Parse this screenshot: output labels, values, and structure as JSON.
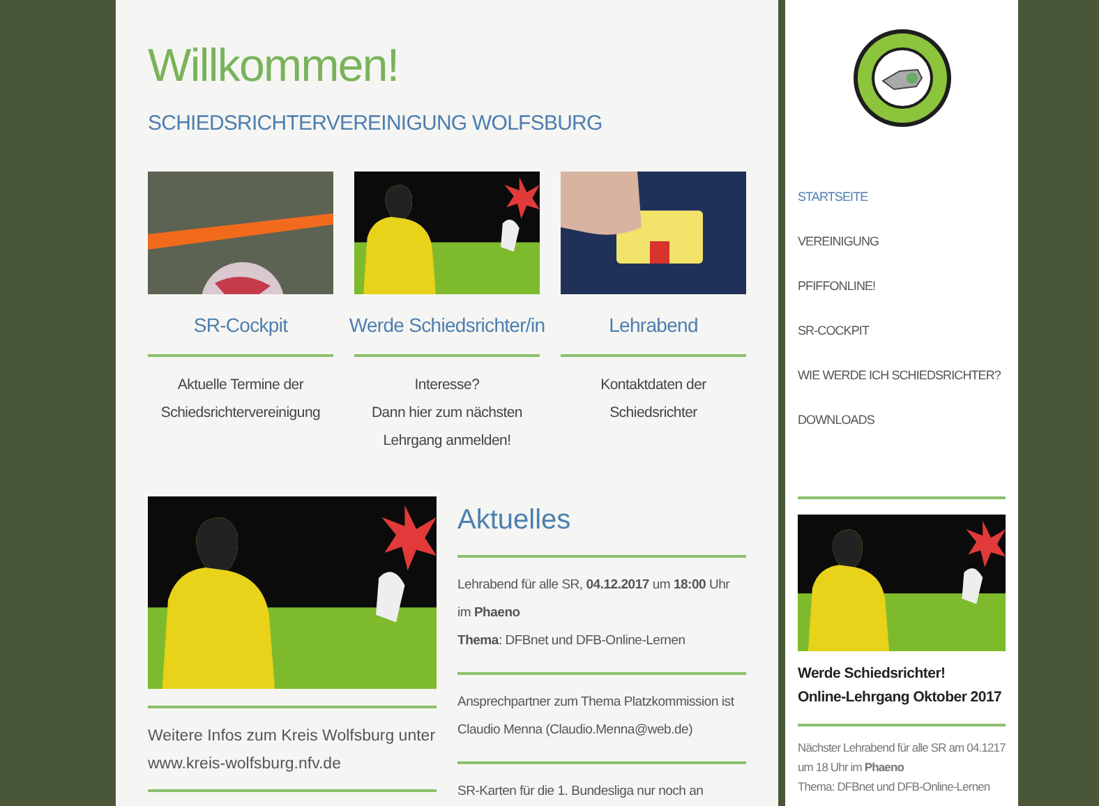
{
  "header": {
    "title": "Willkommen!",
    "subtitle": "SCHIEDSRICHTERVEREINIGUNG WOLFSBURG"
  },
  "cards": [
    {
      "kind": "flag",
      "title": "SR-Cockpit",
      "lines": [
        "Aktuelle Termine der",
        "Schiedsrichtervereinigung"
      ]
    },
    {
      "kind": "poster",
      "title": "Werde Schiedsrichter/in",
      "lines": [
        "Interesse?",
        "Dann hier zum nächsten",
        "Lehrgang anmelden!"
      ]
    },
    {
      "kind": "card",
      "title": "Lehrabend",
      "lines": [
        "Kontaktdaten der",
        "Schiedsrichter"
      ]
    }
  ],
  "info": {
    "text": "Weitere Infos zum Kreis Wolfsburg unter www.kreis-wolfsburg.nfv.de"
  },
  "news": {
    "title": "Aktuelles",
    "items": [
      {
        "lines": [
          "Lehrabend für alle SR, **04.12.2017** um **18:00** Uhr",
          "im **Phaeno**",
          "**Thema**: DFBnet und DFB-Online-Lernen"
        ]
      },
      {
        "lines": [
          "Ansprechpartner zum Thema Platzkommission ist",
          "Claudio Menna (Claudio.Menna@web.de)"
        ]
      },
      {
        "lines": [
          "SR-Karten für die 1. Bundesliga nur noch an"
        ]
      }
    ]
  },
  "nav": [
    {
      "label": "STARTSEITE",
      "selected": true
    },
    {
      "label": "VEREINIGUNG",
      "selected": false
    },
    {
      "label": "PFIFFONLINE!",
      "selected": false
    },
    {
      "label": "SR-COCKPIT",
      "selected": false
    },
    {
      "label": "WIE WERDE ICH SCHIEDSRICHTER?",
      "selected": false
    },
    {
      "label": "DOWNLOADS",
      "selected": false
    }
  ],
  "sidebar": {
    "promo_lines": [
      "Werde Schiedsrichter!",
      "Online-Lehrgang Oktober 2017"
    ],
    "note_lines": [
      "Nächster Lehrabend für alle SR am 04.1217",
      "um 18 Uhr im **Phaeno**",
      "Thema: DFBnet und DFB-Online-Lernen"
    ]
  }
}
